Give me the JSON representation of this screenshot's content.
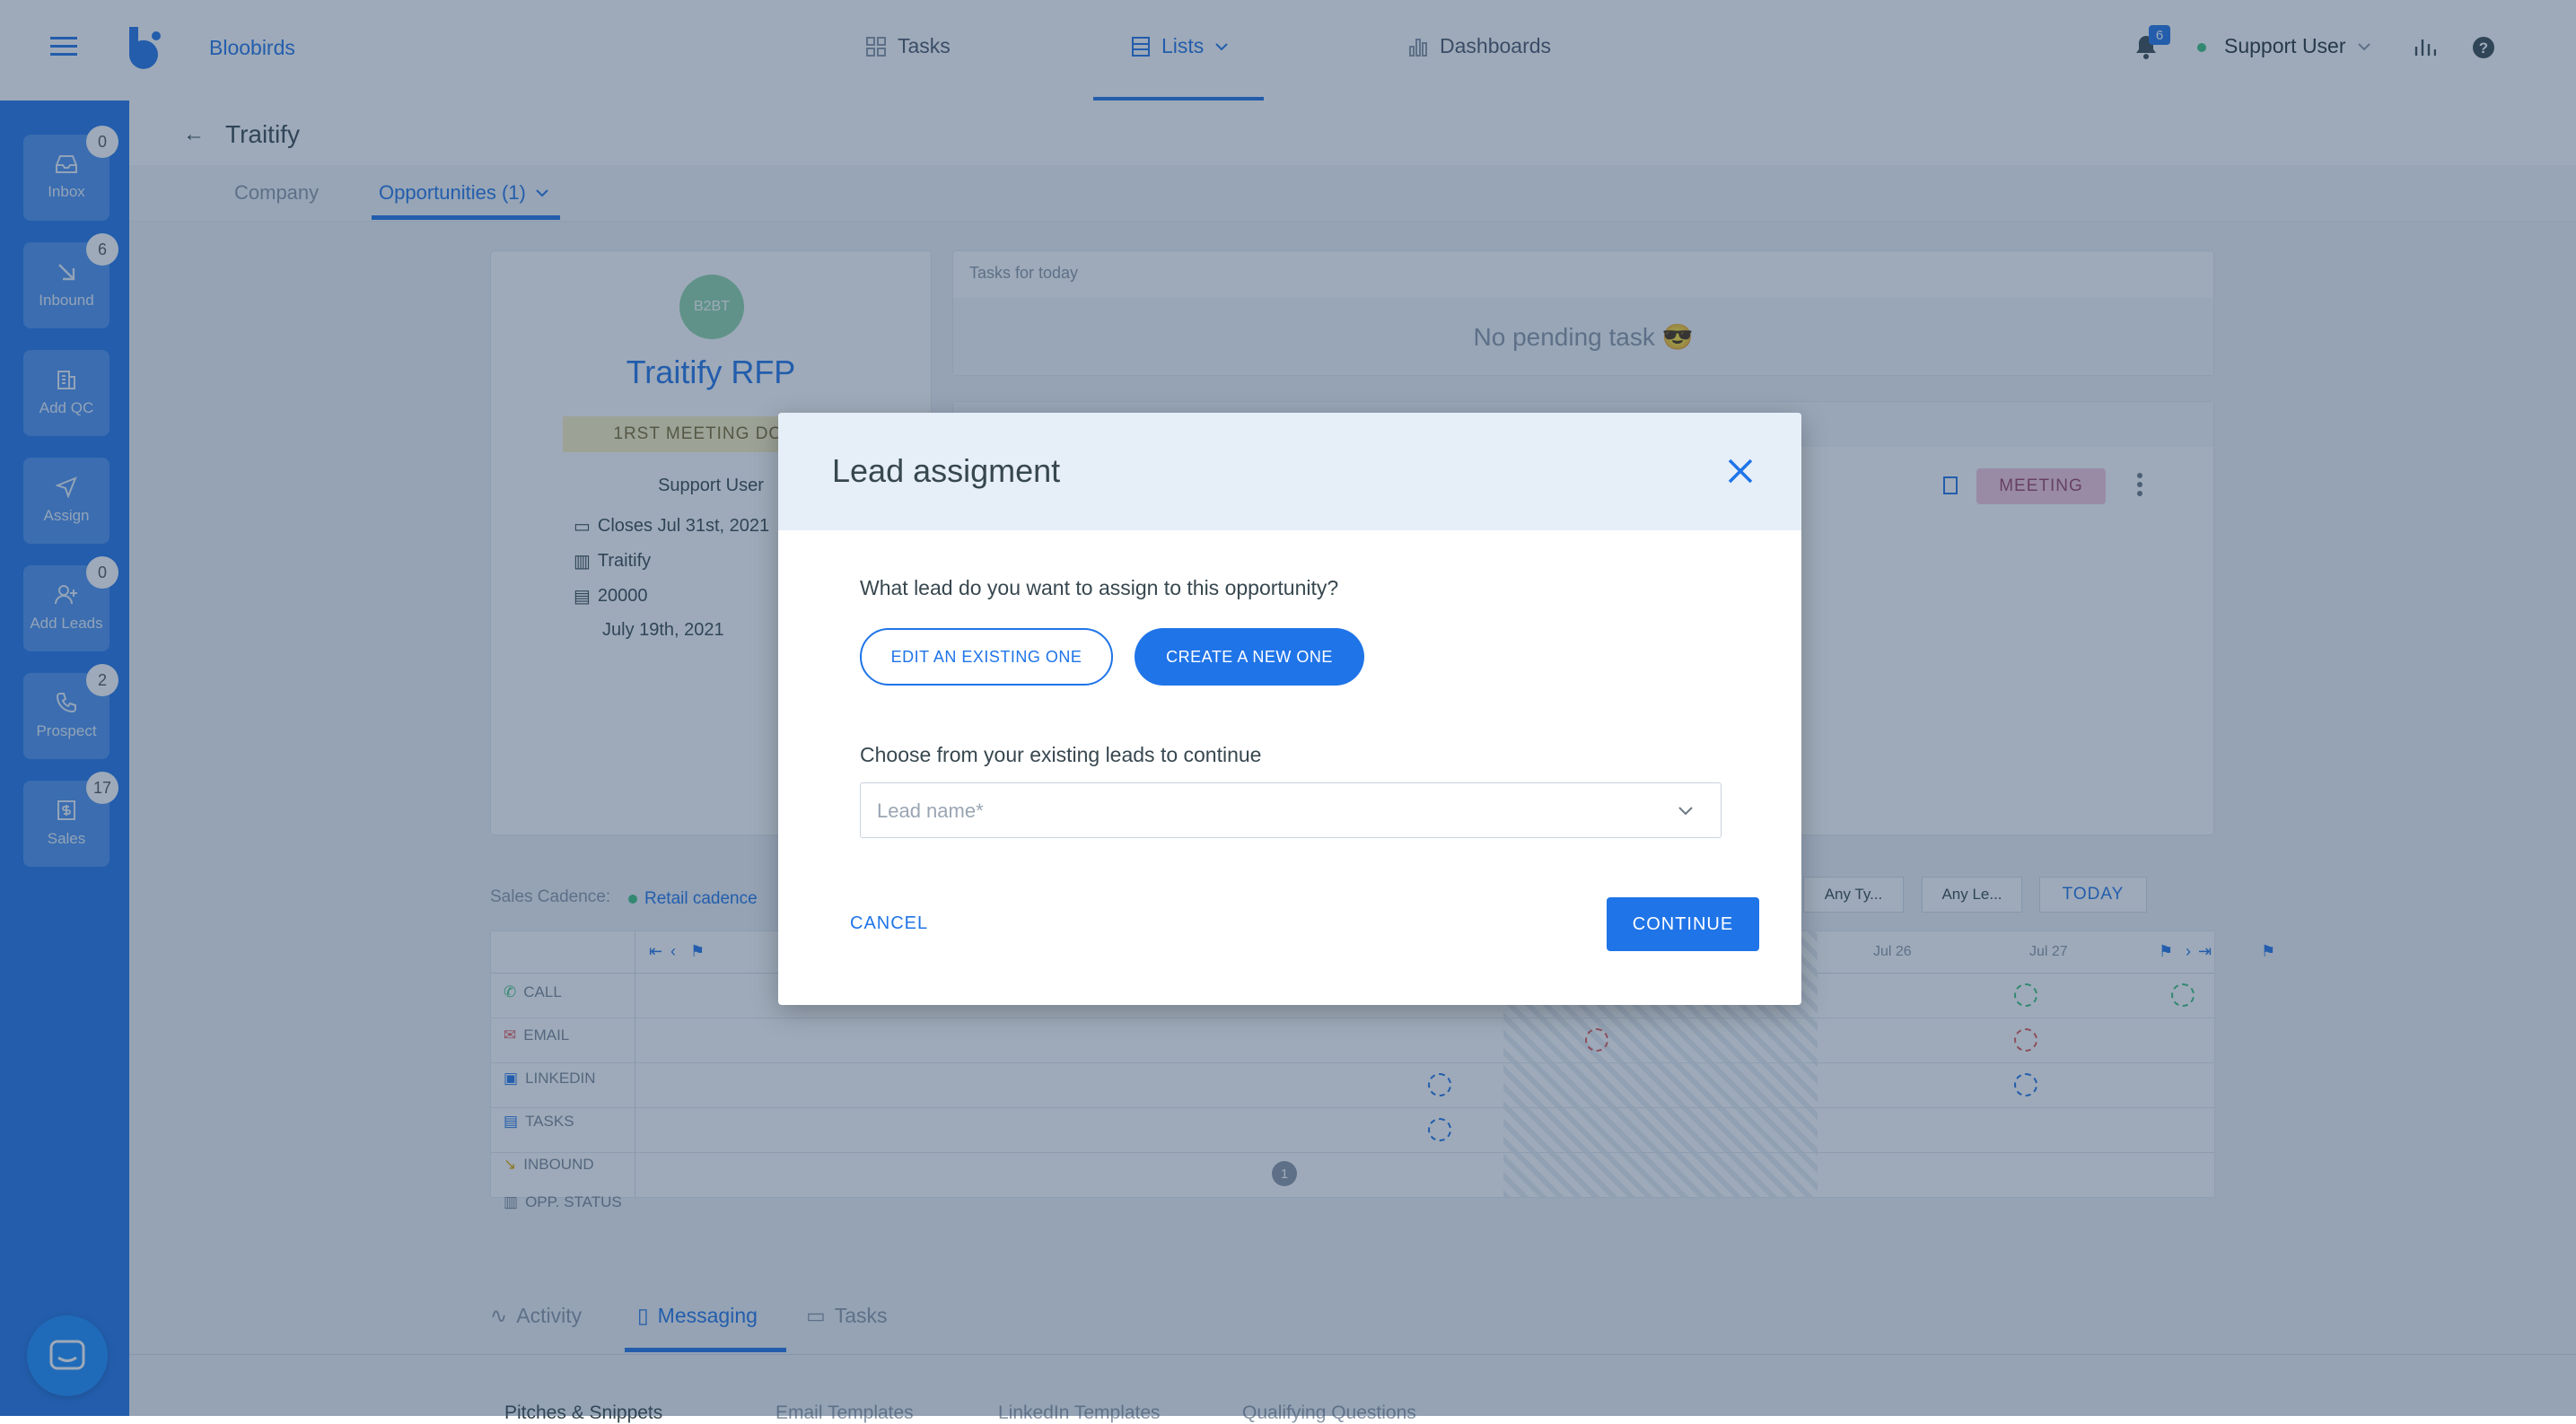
{
  "app": {
    "brand": "Bloobirds"
  },
  "topnav": {
    "tasks": "Tasks",
    "lists": "Lists",
    "dashboards": "Dashboards",
    "notifications_count": "6",
    "user": "Support User"
  },
  "sidebar": {
    "items": [
      {
        "label": "Inbox",
        "badge": "0",
        "icon": "inbox-icon"
      },
      {
        "label": "Inbound",
        "badge": "6",
        "icon": "arrow-down-right-icon"
      },
      {
        "label": "Add QC",
        "badge": "",
        "icon": "building-icon"
      },
      {
        "label": "Assign",
        "badge": "",
        "icon": "send-icon"
      },
      {
        "label": "Add Leads",
        "badge": "0",
        "icon": "add-person-icon"
      },
      {
        "label": "Prospect",
        "badge": "2",
        "icon": "phone-icon"
      },
      {
        "label": "Sales",
        "badge": "17",
        "icon": "dollar-icon"
      }
    ]
  },
  "page": {
    "title": "Traitify",
    "tabs": {
      "company": "Company",
      "opportunities": "Opportunities (1)"
    }
  },
  "opportunity": {
    "avatar": "B2BT",
    "name": "Traitify RFP",
    "stage": "1RST MEETING DONE",
    "owner": "Support User",
    "closes": "Closes Jul 31st, 2021",
    "company": "Traitify",
    "amount": "20000",
    "date": "July 19th, 2021"
  },
  "tasks_today": {
    "header": "Tasks for today",
    "empty": "No pending task 😎"
  },
  "activity_item": {
    "badge": "MEETING"
  },
  "cadence": {
    "label": "Sales Cadence:",
    "name": "Retail cadence",
    "filters": [
      "Any Ty...",
      "Any Le..."
    ],
    "today": "TODAY",
    "dates": [
      "Jul 26",
      "Jul 27"
    ],
    "rows": [
      "CALL",
      "EMAIL",
      "LINKEDIN",
      "TASKS",
      "INBOUND",
      "OPP. STATUS"
    ],
    "opp_status_count": "1"
  },
  "bottom_tabs": {
    "activity": "Activity",
    "messaging": "Messaging",
    "tasks": "Tasks"
  },
  "bottom_subtabs": [
    "Pitches & Snippets",
    "Email Templates",
    "LinkedIn Templates",
    "Qualifying Questions"
  ],
  "modal": {
    "title": "Lead assigment",
    "question": "What lead do you want to assign to this opportunity?",
    "edit_button": "EDIT AN EXISTING ONE",
    "create_button": "CREATE A NEW ONE",
    "choose_label": "Choose from your existing leads to continue",
    "lead_placeholder": "Lead name*",
    "cancel": "CANCEL",
    "continue": "CONTINUE"
  },
  "colors": {
    "primary": "#1f74e8",
    "meeting_badge": "#f6c6dc",
    "stage_badge": "#fdf0c2",
    "avatar": "#8fd3a8"
  }
}
